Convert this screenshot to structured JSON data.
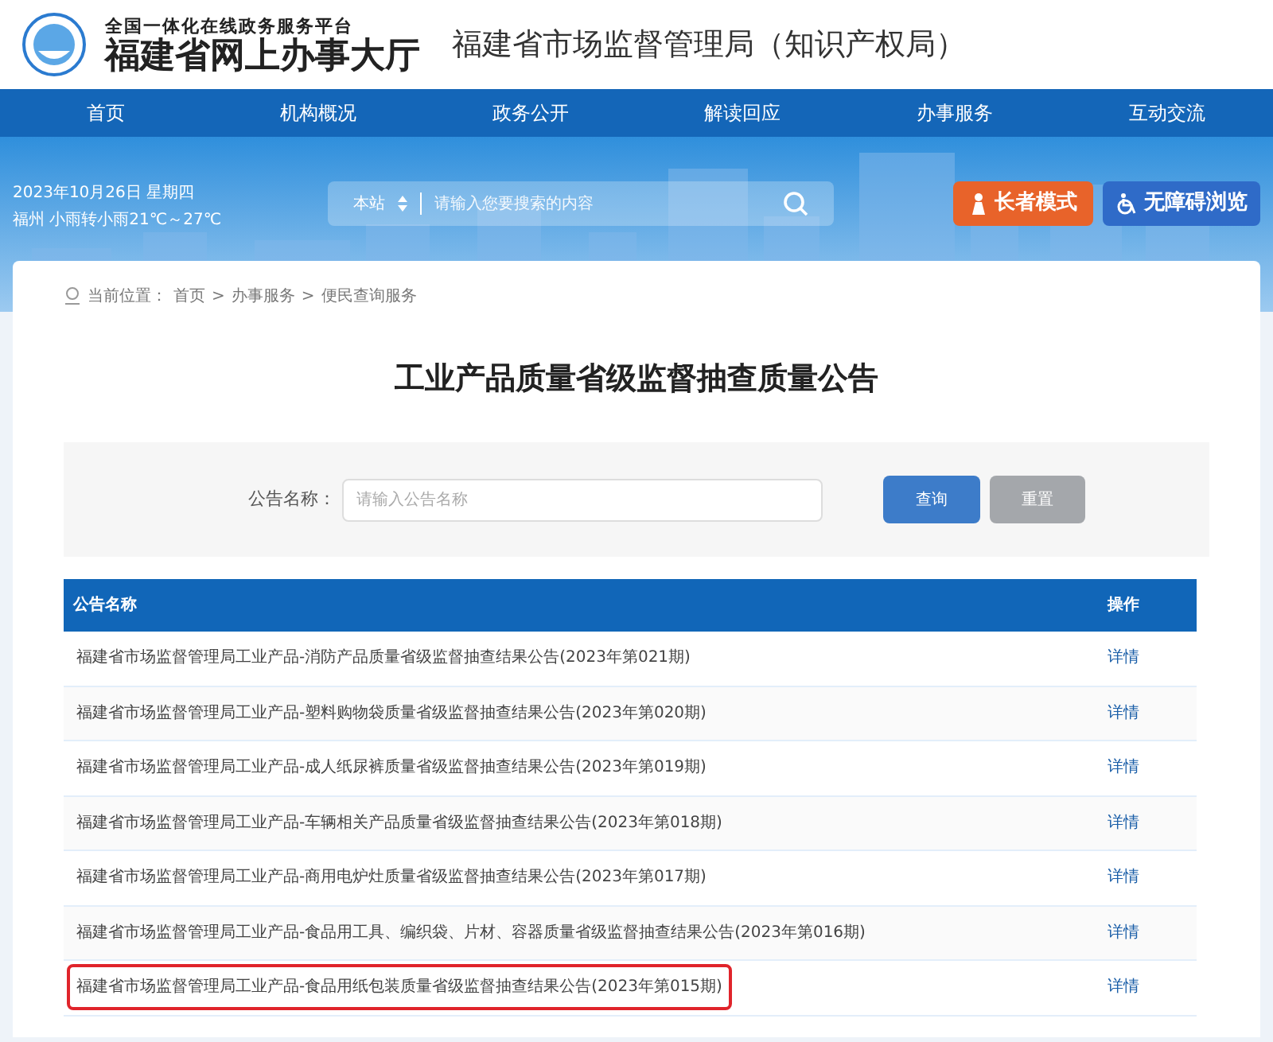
{
  "header": {
    "platform_tagline": "全国一体化在线政务服务平台",
    "platform_name": "福建省网上办事大厅",
    "department": "福建省市场监督管理局（知识产权局）"
  },
  "nav": [
    "首页",
    "机构概况",
    "政务公开",
    "解读回应",
    "办事服务",
    "互动交流"
  ],
  "banner": {
    "date": "2023年10月26日 星期四",
    "weather": "福州 小雨转小雨21℃～27℃",
    "search_scope": "本站",
    "search_placeholder": "请输入您要搜索的内容",
    "elder_mode": "长者模式",
    "accessibility": "无障碍浏览"
  },
  "breadcrumb": {
    "label": "当前位置：",
    "separator": ">",
    "items": [
      "首页",
      "办事服务",
      "便民查询服务"
    ]
  },
  "page_title": "工业产品质量省级监督抽查质量公告",
  "filter": {
    "label": "公告名称：",
    "placeholder": "请输入公告名称",
    "search_button": "查询",
    "reset_button": "重置"
  },
  "table": {
    "columns": [
      "公告名称",
      "操作"
    ],
    "rows": [
      {
        "name": "福建省市场监督管理局工业产品-消防产品质量省级监督抽查结果公告(2023年第021期)",
        "action": "详情",
        "highlighted": false
      },
      {
        "name": "福建省市场监督管理局工业产品-塑料购物袋质量省级监督抽查结果公告(2023年第020期)",
        "action": "详情",
        "highlighted": false
      },
      {
        "name": "福建省市场监督管理局工业产品-成人纸尿裤质量省级监督抽查结果公告(2023年第019期)",
        "action": "详情",
        "highlighted": false
      },
      {
        "name": "福建省市场监督管理局工业产品-车辆相关产品质量省级监督抽查结果公告(2023年第018期)",
        "action": "详情",
        "highlighted": false
      },
      {
        "name": "福建省市场监督管理局工业产品-商用电炉灶质量省级监督抽查结果公告(2023年第017期)",
        "action": "详情",
        "highlighted": false
      },
      {
        "name": "福建省市场监督管理局工业产品-食品用工具、编织袋、片材、容器质量省级监督抽查结果公告(2023年第016期)",
        "action": "详情",
        "highlighted": false
      },
      {
        "name": "福建省市场监督管理局工业产品-食品用纸包装质量省级监督抽查结果公告(2023年第015期)",
        "action": "详情",
        "highlighted": true
      }
    ]
  }
}
